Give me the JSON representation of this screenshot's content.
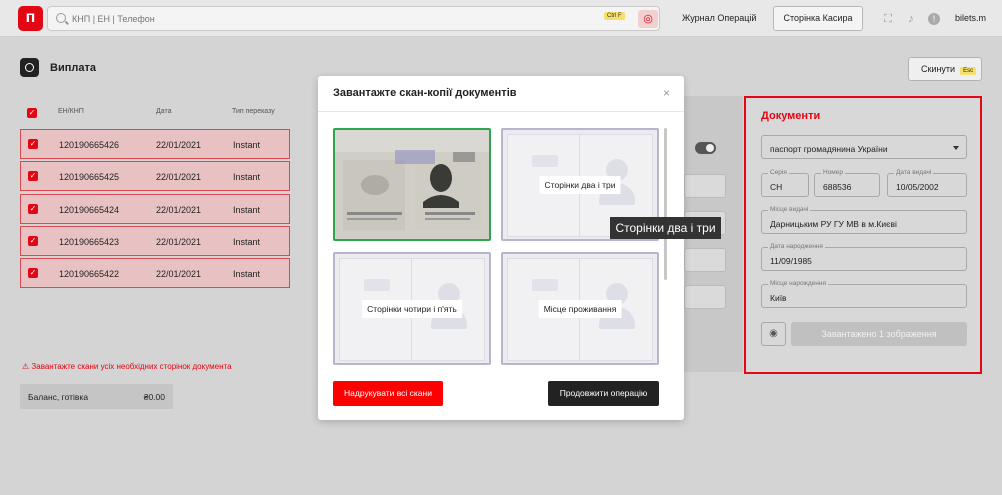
{
  "header": {
    "logo": "п",
    "search_placeholder": "КНП | ЕН | Телефон",
    "search_shortcut": "Ctrl F",
    "journal": "Журнал Операцій",
    "cashier_page": "Сторінка Касира",
    "user": "bilets.m"
  },
  "page": {
    "title": "Виплата",
    "reset": "Скинути",
    "reset_shortcut": "Esc"
  },
  "table": {
    "columns": [
      "ЕН/КНП",
      "Дата",
      "Тип переказу"
    ],
    "rows": [
      {
        "id": "120190665426",
        "date": "22/01/2021",
        "type": "Instant"
      },
      {
        "id": "120190665425",
        "date": "22/01/2021",
        "type": "Instant"
      },
      {
        "id": "120190665424",
        "date": "22/01/2021",
        "type": "Instant"
      },
      {
        "id": "120190665423",
        "date": "22/01/2021",
        "type": "Instant"
      },
      {
        "id": "120190665422",
        "date": "22/01/2021",
        "type": "Instant"
      }
    ]
  },
  "warning": "Завантажте скани усіх необхідних сторінок документа",
  "balance": {
    "label": "Баланс, готівка",
    "value": "₴0.00"
  },
  "documents": {
    "title": "Документи",
    "doc_type": "паспорт громадянина України",
    "series_label": "Серія",
    "series": "СН",
    "number_label": "Номер",
    "number": "688536",
    "issue_date_label": "Дата видачі",
    "issue_date": "10/05/2002",
    "issued_by_label": "Місце видачі",
    "issued_by": "Дарницьким РУ ГУ МВ в м.Києві",
    "birth_date_label": "Дата народження",
    "birth_date": "11/09/1985",
    "birth_place_label": "Місце нарождення",
    "birth_place": "Київ",
    "loaded": "Завантажено 1 зображення"
  },
  "modal": {
    "title": "Завантажте скан-копії документів",
    "close": "×",
    "cards": [
      "Сторінки два і три",
      "Сторінки чотири і п'ять",
      "Місце проживання"
    ],
    "print_all": "Надрукувати всі скани",
    "continue": "Продовжити операцію"
  },
  "tooltip": "Сторінки два і три",
  "colors": {
    "accent": "#e30613",
    "success": "#2ea44f"
  }
}
